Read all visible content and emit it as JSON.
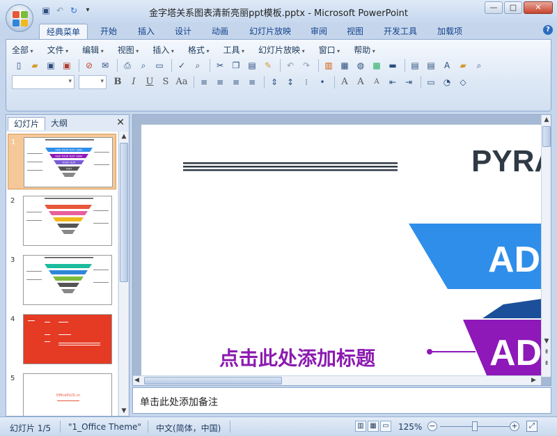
{
  "window": {
    "title": "金字塔关系图表清新亮丽ppt模板.pptx - Microsoft PowerPoint",
    "controls": [
      "—",
      "□",
      "✕"
    ]
  },
  "ribbon_tabs": [
    {
      "label": "经典菜单",
      "active": true
    },
    {
      "label": "开始"
    },
    {
      "label": "插入"
    },
    {
      "label": "设计"
    },
    {
      "label": "动画"
    },
    {
      "label": "幻灯片放映"
    },
    {
      "label": "审阅"
    },
    {
      "label": "视图"
    },
    {
      "label": "开发工具"
    },
    {
      "label": "加载项"
    }
  ],
  "classic_menu": [
    "全部",
    "文件",
    "编辑",
    "视图",
    "插入",
    "格式",
    "工具",
    "幻灯片放映",
    "窗口",
    "帮助"
  ],
  "panel": {
    "tabs": [
      "幻灯片",
      "大纲"
    ],
    "active_tab": "幻灯片",
    "slide_numbers": [
      "1",
      "2",
      "3",
      "4",
      "5"
    ],
    "thumb_logo": "OfficePLUS.cn",
    "thumb_bars": [
      "ADD YOUR TEXT HERE",
      "ADD YOUR TEXT HERE",
      "YOUR TEXT",
      "TEXT"
    ]
  },
  "slide": {
    "title_fragment": "PYRA",
    "band1_text": "AD",
    "band2_text": "AD",
    "placeholder_title": "点击此处添加标题"
  },
  "notes": {
    "placeholder": "单击此处添加备注"
  },
  "status": {
    "slide_info": "幻灯片 1/5",
    "theme": "\"1_Office Theme\"",
    "language": "中文(简体，中国)",
    "zoom": "125%"
  },
  "colors": {
    "accent_blue": "#2f8eea",
    "accent_purple": "#8e18b8",
    "title_purple": "#8b1ab0",
    "selection_orange": "#f5c89a",
    "slide4_red": "#e53a24"
  }
}
